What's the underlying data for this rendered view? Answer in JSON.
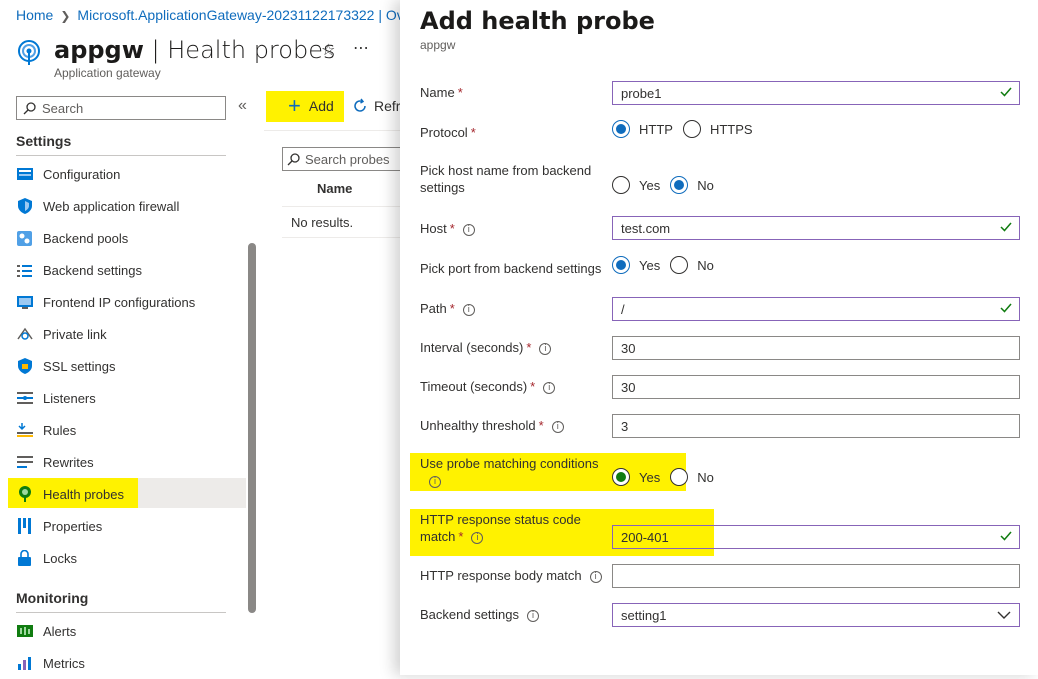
{
  "breadcrumb": {
    "home": "Home",
    "item": "Microsoft.ApplicationGateway-20231122173322 | Ov"
  },
  "resource": {
    "name": "appgw",
    "section": "| Health probes",
    "type": "Application gateway"
  },
  "nav": {
    "search_placeholder": "Search",
    "settings_header": "Settings",
    "items": [
      {
        "label": "Configuration",
        "icon": "configuration-icon"
      },
      {
        "label": "Web application firewall",
        "icon": "shield-icon"
      },
      {
        "label": "Backend pools",
        "icon": "backend-pools-icon"
      },
      {
        "label": "Backend settings",
        "icon": "list-settings-icon"
      },
      {
        "label": "Frontend IP configurations",
        "icon": "frontend-ip-icon"
      },
      {
        "label": "Private link",
        "icon": "private-link-icon"
      },
      {
        "label": "SSL settings",
        "icon": "ssl-shield-icon"
      },
      {
        "label": "Listeners",
        "icon": "listeners-icon"
      },
      {
        "label": "Rules",
        "icon": "rules-icon"
      },
      {
        "label": "Rewrites",
        "icon": "rewrites-icon"
      },
      {
        "label": "Health probes",
        "icon": "health-probe-icon"
      },
      {
        "label": "Properties",
        "icon": "properties-icon"
      },
      {
        "label": "Locks",
        "icon": "lock-icon"
      }
    ],
    "monitoring_header": "Monitoring",
    "monitoring_items": [
      {
        "label": "Alerts",
        "icon": "alerts-icon"
      },
      {
        "label": "Metrics",
        "icon": "metrics-icon"
      }
    ]
  },
  "list": {
    "add_label": "Add",
    "refresh_label": "Refresh",
    "search_placeholder": "Search probes",
    "column_name": "Name",
    "empty_text": "No results."
  },
  "panel": {
    "title": "Add health probe",
    "subtitle": "appgw",
    "name_label": "Name",
    "name_value": "probe1",
    "protocol_label": "Protocol",
    "protocol_options": [
      "HTTP",
      "HTTPS"
    ],
    "protocol_selected": "HTTP",
    "pick_host_label": "Pick host name from backend settings",
    "pick_host_options": [
      "Yes",
      "No"
    ],
    "pick_host_selected": "No",
    "host_label": "Host",
    "host_value": "test.com",
    "pick_port_label": "Pick port from backend settings",
    "pick_port_options": [
      "Yes",
      "No"
    ],
    "pick_port_selected": "Yes",
    "path_label": "Path",
    "path_value": "/",
    "interval_label": "Interval (seconds)",
    "interval_value": "30",
    "timeout_label": "Timeout (seconds)",
    "timeout_value": "30",
    "unhealthy_label": "Unhealthy threshold",
    "unhealthy_value": "3",
    "use_match_label": "Use probe matching conditions",
    "use_match_options": [
      "Yes",
      "No"
    ],
    "use_match_selected": "Yes",
    "status_match_label": "HTTP response status code match",
    "status_match_value": "200-401",
    "body_match_label": "HTTP response body match",
    "body_match_value": "",
    "backend_settings_label": "Backend settings",
    "backend_settings_value": "setting1",
    "required_mark": "*",
    "info_glyph": "i"
  },
  "colors": {
    "accent": "#0f6cbd",
    "highlight": "#fff200",
    "valid_border": "#8764b8",
    "valid_check": "#107c10",
    "required": "#a4262c"
  }
}
